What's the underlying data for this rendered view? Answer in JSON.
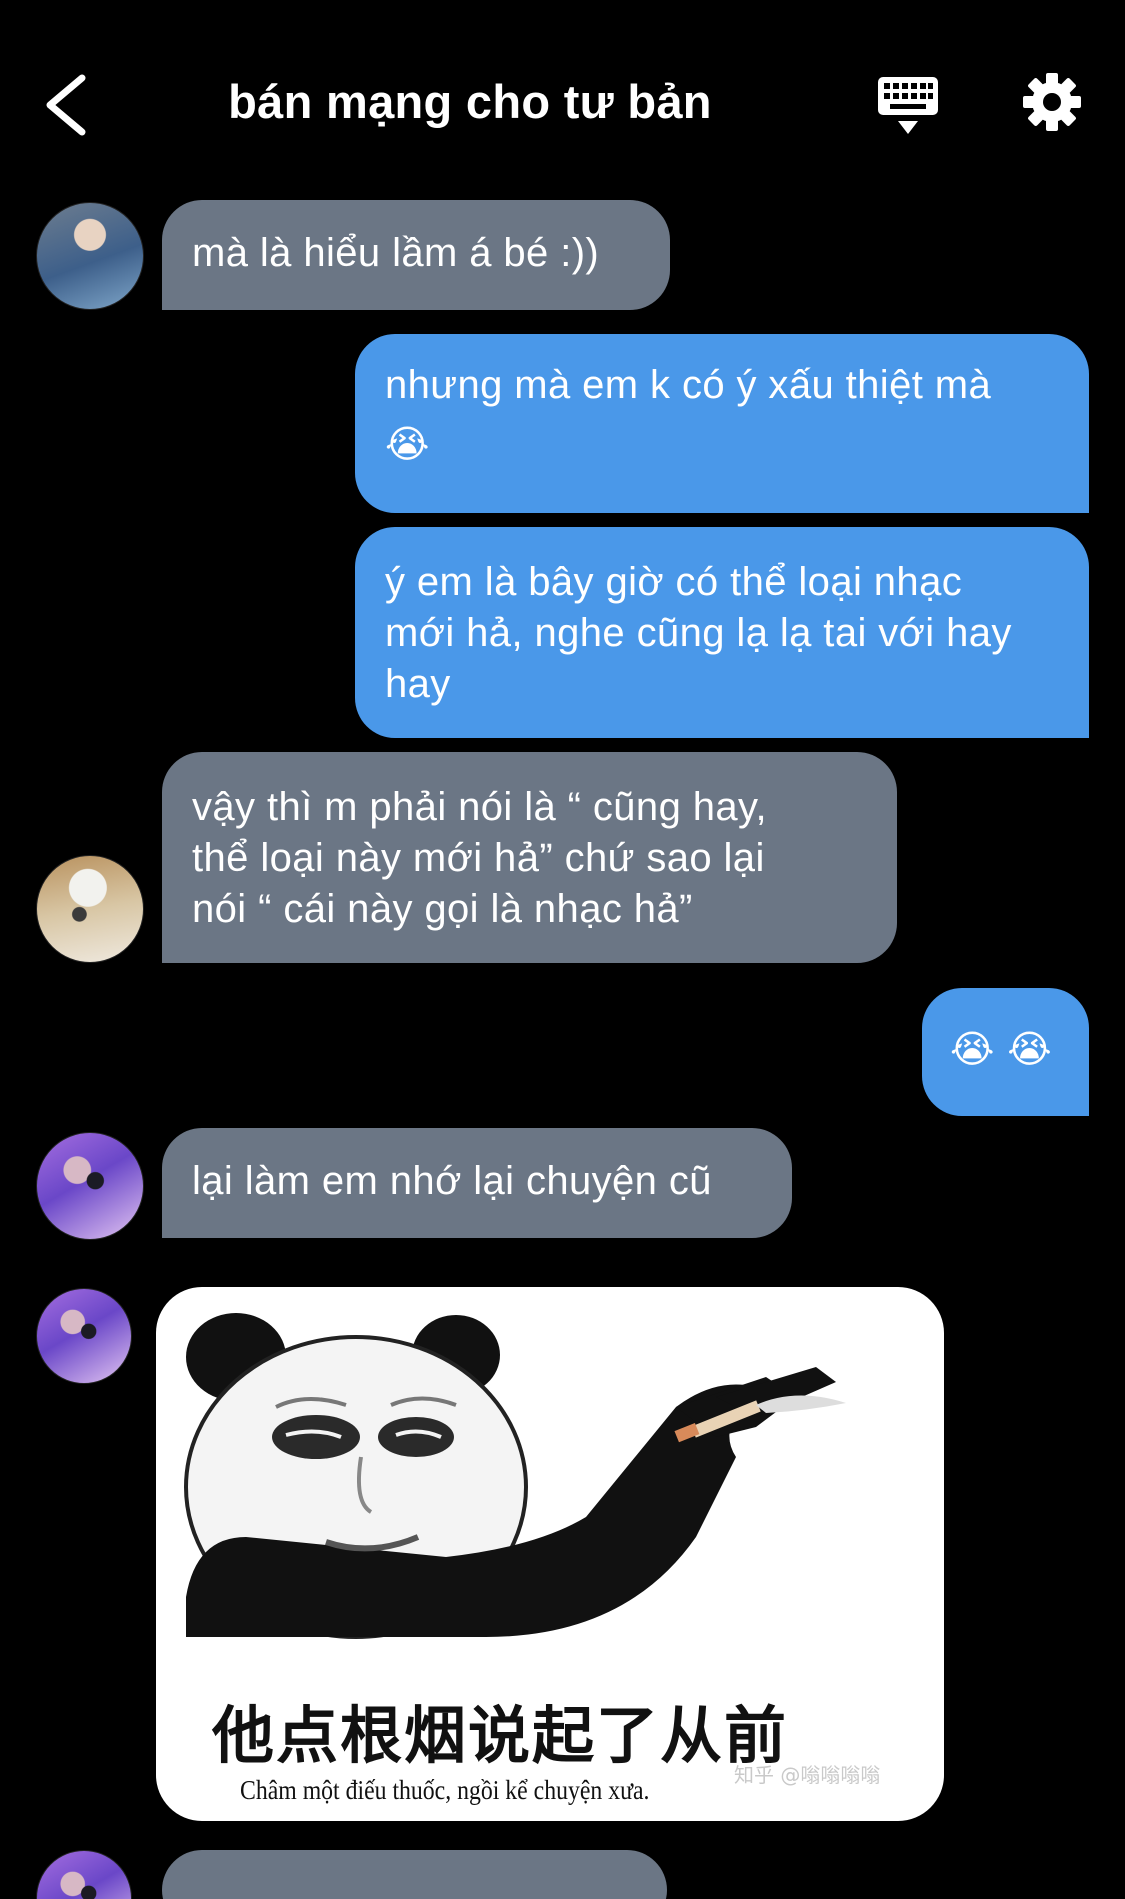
{
  "header": {
    "title": "bán mạng cho tư bản"
  },
  "messages": [
    {
      "side": "in",
      "text": "mà là hiểu lầm á bé :))"
    },
    {
      "side": "out",
      "line1": "nhưng mà em k có ý xấu thiệt mà",
      "emoji": "😭"
    },
    {
      "side": "out",
      "lines": [
        "ý em là bây giờ có thể loại nhạc",
        "mới hả, nghe cũng lạ lạ tai với hay",
        "hay"
      ]
    },
    {
      "side": "in",
      "lines": [
        "vậy thì m phải nói là “ cũng hay,",
        "thể loại này mới hả” chứ sao lại",
        "nói “ cái này gọi là nhạc hả”"
      ]
    },
    {
      "side": "out",
      "emoji": "😭 😭"
    },
    {
      "side": "in",
      "text": "lại làm em nhớ lại chuyện cũ"
    }
  ],
  "sticker": {
    "caption_zh": "他点根烟说起了从前",
    "caption_vi": "Châm một điếu thuốc, ngồi kể chuyện xưa.",
    "watermark": "知乎 @嗡嗡嗡嗡"
  },
  "colors": {
    "background": "#000000",
    "incoming_bubble": "#6b7685",
    "outgoing_bubble": "#4a98e9",
    "text": "#ffffff"
  },
  "icons": [
    "back-arrow-icon",
    "keyboard-icon",
    "gear-icon"
  ]
}
